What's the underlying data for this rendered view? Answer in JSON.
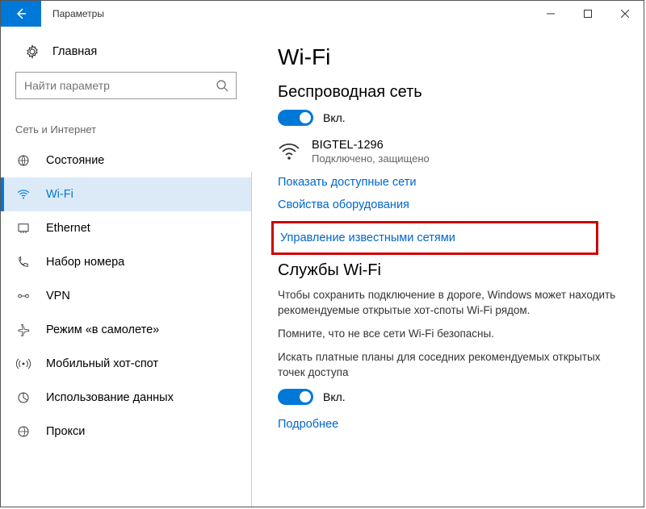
{
  "titlebar": {
    "title": "Параметры"
  },
  "sidebar": {
    "home_label": "Главная",
    "search_placeholder": "Найти параметр",
    "section_header": "Сеть и Интернет",
    "items": [
      {
        "label": "Состояние"
      },
      {
        "label": "Wi-Fi"
      },
      {
        "label": "Ethernet"
      },
      {
        "label": "Набор номера"
      },
      {
        "label": "VPN"
      },
      {
        "label": "Режим «в самолете»"
      },
      {
        "label": "Мобильный хот-спот"
      },
      {
        "label": "Использование данных"
      },
      {
        "label": "Прокси"
      }
    ]
  },
  "content": {
    "h1": "Wi-Fi",
    "wireless_header": "Беспроводная сеть",
    "wireless_toggle_label": "Вкл.",
    "network": {
      "name": "BIGTEL-1296",
      "status": "Подключено, защищено"
    },
    "links": {
      "show_networks": "Показать доступные сети",
      "hardware_props": "Свойства оборудования",
      "manage_known": "Управление известными сетями",
      "learn_more": "Подробнее"
    },
    "services_header": "Службы Wi-Fi",
    "services_para1": "Чтобы сохранить подключение в дороге, Windows может находить рекомендуемые открытые хот-споты Wi-Fi рядом.",
    "services_para2": "Помните, что не все сети Wi-Fi безопасны.",
    "services_para3": "Искать платные планы для соседних рекомендуемых открытых точек доступа",
    "services_toggle_label": "Вкл."
  }
}
